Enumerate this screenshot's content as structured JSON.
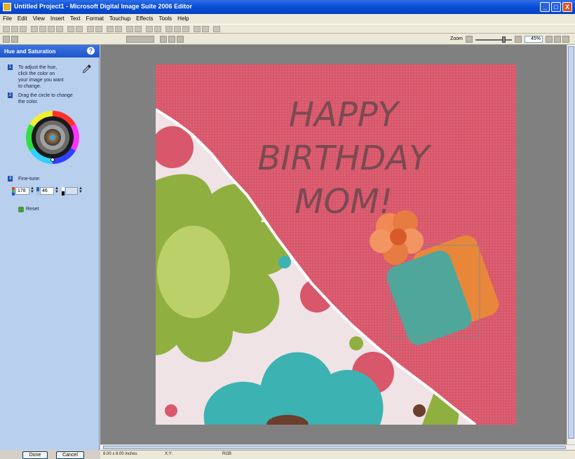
{
  "window": {
    "title": "Untitled Project1 - Microsoft Digital Image Suite 2006 Editor",
    "minimize": "_",
    "maximize": "□",
    "close": "X"
  },
  "menu": [
    "File",
    "Edit",
    "View",
    "Insert",
    "Text",
    "Format",
    "Touchup",
    "Effects",
    "Tools",
    "Help"
  ],
  "zoom": {
    "label": "Zoom",
    "value": "45%"
  },
  "palette": {
    "title": "Hue and Saturation",
    "help_icon": "?",
    "steps": [
      {
        "num": "1",
        "text": [
          "To adjust the hue,",
          "click the color on",
          "your image you want",
          "to change."
        ]
      },
      {
        "num": "2",
        "text": [
          "Drag the circle to change",
          "the color."
        ]
      },
      {
        "num": "3",
        "text": [
          "Fine-tune:"
        ]
      }
    ],
    "fields": {
      "hue": "178",
      "saturation": "46"
    },
    "reset_label": "Reset",
    "done_label": "Done",
    "cancel_label": "Cancel"
  },
  "canvas": {
    "greeting_lines": [
      "HAPPY",
      "BIRTHDAY",
      "MOM!"
    ]
  },
  "status": {
    "size": "8.00 x 8.00 inches",
    "position": "X:Y:",
    "mode": "RGB"
  },
  "colors": {
    "pink_background": "#d9576b",
    "flower_green": "#8fb040",
    "flower_teal": "#3cb3b2",
    "tag_orange": "#e8873a",
    "tag_teal": "#4ea79a"
  }
}
